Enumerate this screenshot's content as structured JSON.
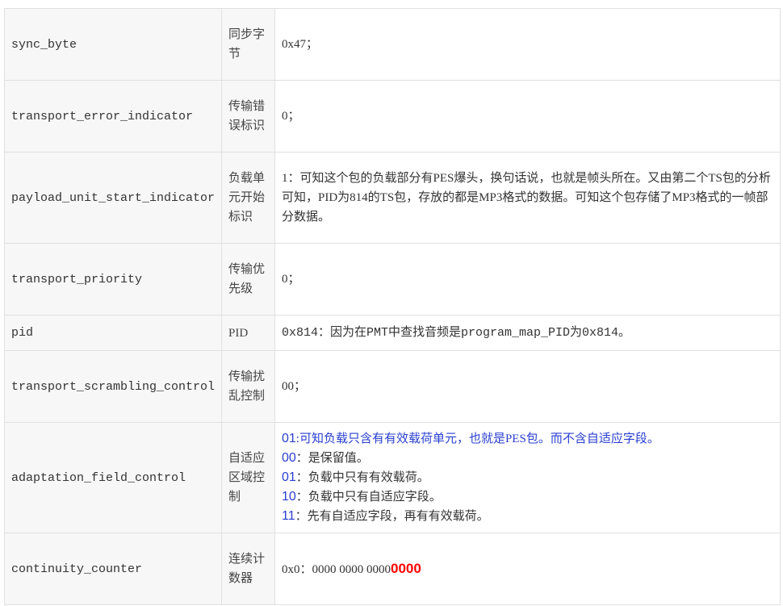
{
  "rows": [
    {
      "field": "sync_byte",
      "name": "同步字节",
      "desc": "0x47；"
    },
    {
      "field": "transport_error_indicator",
      "name": "传输错误标识",
      "desc": "0；"
    },
    {
      "field": "payload_unit_start_indicator",
      "name": "负载单元开始标识",
      "desc": "1：可知这个包的负载部分有PES爆头，换句话说，也就是帧头所在。又由第二个TS包的分析可知，PID为814的TS包，存放的都是MP3格式的数据。可知这个包存储了MP3格式的一帧部分数据。"
    },
    {
      "field": "transport_priority",
      "name": "传输优先级",
      "desc": "0；"
    },
    {
      "field": "pid",
      "name": "PID",
      "desc": "0x814：因为在PMT中查找音频是program_map_PID为0x814。"
    },
    {
      "field": "transport_scrambling_control",
      "name": "传输扰乱控制",
      "desc": "00；"
    },
    {
      "field": "adaptation_field_control",
      "name": "自适应区域控制",
      "lines": [
        {
          "num": "01",
          "text": ":可知负载只含有有效载荷单元，也就是PES包。而不含自适应字段。"
        },
        {
          "num": "00",
          "text": "：是保留值。"
        },
        {
          "num": "01",
          "text": "：负载中只有有效载荷。"
        },
        {
          "num": "10",
          "text": "：负载中只有自适应字段。"
        },
        {
          "num": "11",
          "text": "：先有自适应字段，再有有效载荷。"
        }
      ]
    },
    {
      "field": "continuity_counter",
      "name": "连续计数器",
      "desc_prefix": "0x0：0000 0000 0000",
      "desc_highlight": "0000"
    }
  ]
}
